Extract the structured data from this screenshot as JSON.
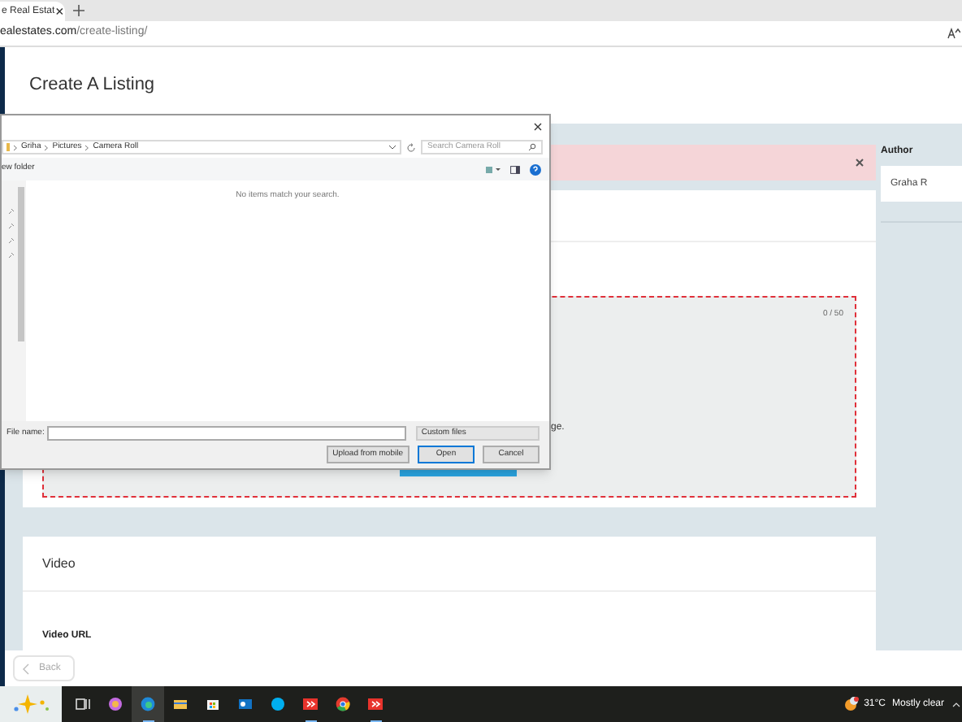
{
  "browser": {
    "tab_title": "e Real Estat",
    "address_host": "ealestates.com",
    "address_path": "/create-listing/"
  },
  "page": {
    "title": "Create A Listing",
    "author_label": "Author",
    "author_value": "Graha R",
    "upload_counter": "0 / 50",
    "upload_hint": "ge.",
    "video_title": "Video",
    "video_url_label": "Video URL",
    "back_button": "Back"
  },
  "file_dialog": {
    "breadcrumb": [
      "Griha",
      "Pictures",
      "Camera Roll"
    ],
    "search_placeholder": "Search Camera Roll",
    "new_folder": "ew folder",
    "empty_message": "No items match your search.",
    "file_name_label": "File name:",
    "file_type": "Custom files",
    "buttons": [
      {
        "label": "Upload from mobile",
        "default": false
      },
      {
        "label": "Open",
        "default": true
      },
      {
        "label": "Cancel",
        "default": false
      }
    ]
  },
  "taskbar": {
    "temperature": "31°C",
    "weather": "Mostly clear",
    "apps": [
      {
        "kind": "taskview",
        "active": false
      },
      {
        "kind": "copilot",
        "active": false
      },
      {
        "kind": "edge",
        "active": true
      },
      {
        "kind": "folder",
        "active": false
      },
      {
        "kind": "store",
        "active": false
      },
      {
        "kind": "outlook",
        "active": false
      },
      {
        "kind": "skype",
        "active": false
      },
      {
        "kind": "red",
        "active": true
      },
      {
        "kind": "chrome",
        "active": false
      },
      {
        "kind": "red",
        "active": true
      }
    ]
  }
}
